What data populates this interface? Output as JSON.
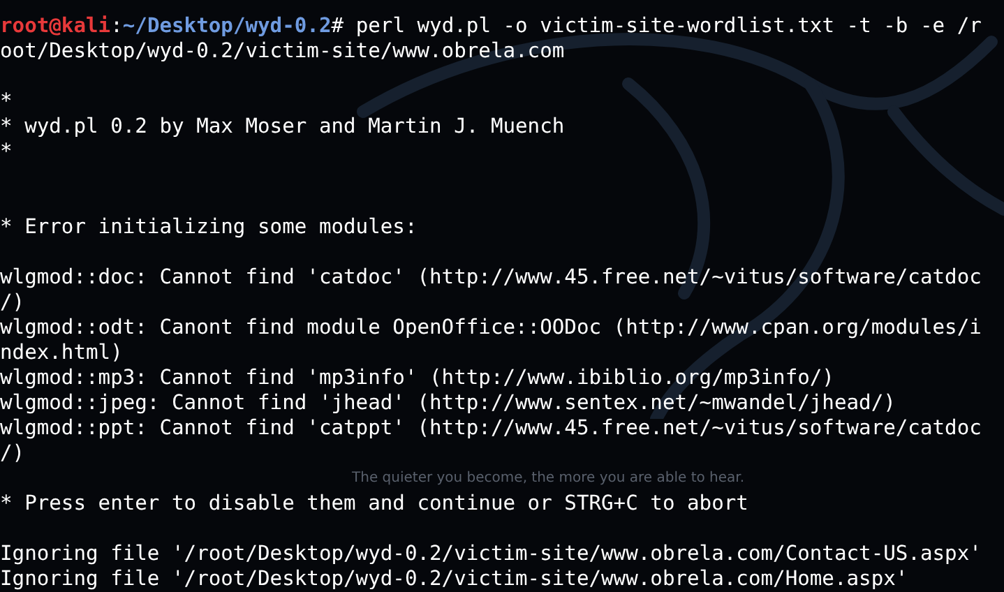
{
  "wallpaper": {
    "tagline": "The quieter you become, the more you are able to hear."
  },
  "terminal": {
    "lines": [
      {
        "kind": "prompt",
        "user": "root@kali",
        "sep": ":",
        "path": "~/Desktop/wyd-0.2",
        "symbol": "#",
        "command": " perl wyd.pl -o victim-site-wordlist.txt -t -b -e /r"
      },
      {
        "kind": "text",
        "text": "oot/Desktop/wyd-0.2/victim-site/www.obrela.com"
      },
      {
        "kind": "blank"
      },
      {
        "kind": "text",
        "text": "*"
      },
      {
        "kind": "text",
        "text": "* wyd.pl 0.2 by Max Moser and Martin J. Muench"
      },
      {
        "kind": "text",
        "text": "*"
      },
      {
        "kind": "blank"
      },
      {
        "kind": "blank"
      },
      {
        "kind": "text",
        "text": "* Error initializing some modules:"
      },
      {
        "kind": "blank"
      },
      {
        "kind": "text",
        "text": "wlgmod::doc: Cannot find 'catdoc' (http://www.45.free.net/~vitus/software/catdoc"
      },
      {
        "kind": "text",
        "text": "/)"
      },
      {
        "kind": "text",
        "text": "wlgmod::odt: Canont find module OpenOffice::OODoc (http://www.cpan.org/modules/i"
      },
      {
        "kind": "text",
        "text": "ndex.html)"
      },
      {
        "kind": "text",
        "text": "wlgmod::mp3: Cannot find 'mp3info' (http://www.ibiblio.org/mp3info/)"
      },
      {
        "kind": "text",
        "text": "wlgmod::jpeg: Cannot find 'jhead' (http://www.sentex.net/~mwandel/jhead/)"
      },
      {
        "kind": "text",
        "text": "wlgmod::ppt: Cannot find 'catppt' (http://www.45.free.net/~vitus/software/catdoc"
      },
      {
        "kind": "text",
        "text": "/)"
      },
      {
        "kind": "blank"
      },
      {
        "kind": "text",
        "text": "* Press enter to disable them and continue or STRG+C to abort"
      },
      {
        "kind": "blank"
      },
      {
        "kind": "text",
        "text": "Ignoring file '/root/Desktop/wyd-0.2/victim-site/www.obrela.com/Contact-US.aspx'"
      },
      {
        "kind": "text",
        "text": "Ignoring file '/root/Desktop/wyd-0.2/victim-site/www.obrela.com/Home.aspx'"
      }
    ]
  }
}
